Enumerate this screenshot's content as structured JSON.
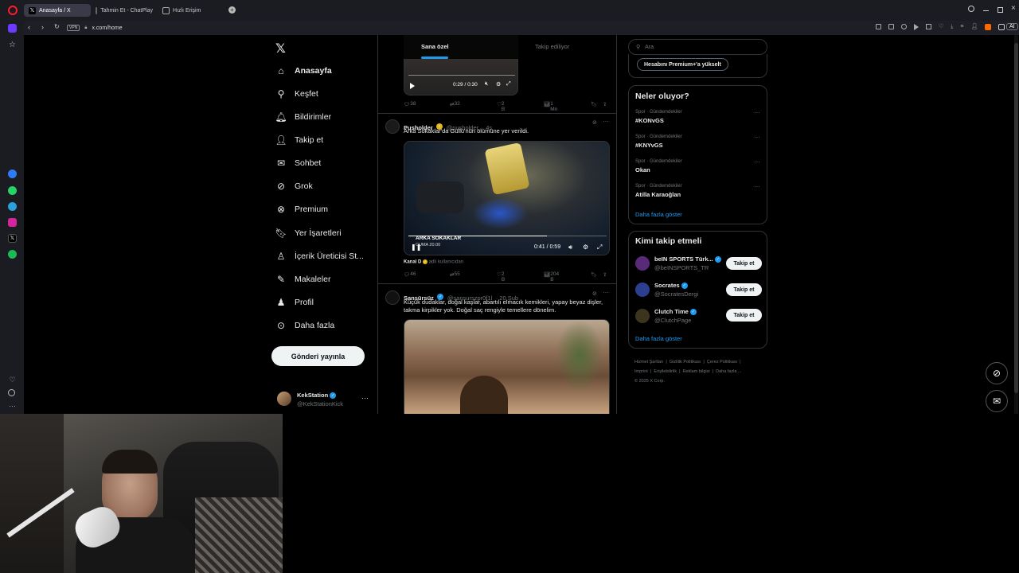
{
  "browser": {
    "tabs": [
      {
        "label": "Anasayfa / X",
        "active": true
      },
      {
        "label": "Tahmin Et - ChatPlay",
        "active": false
      },
      {
        "label": "Hızlı Erişim",
        "active": false
      }
    ],
    "vpn_label": "VPN",
    "url": "x.com/home",
    "ai_label": "AI"
  },
  "nav": {
    "items": [
      {
        "label": "Anasayfa",
        "icon": "home-icon"
      },
      {
        "label": "Keşfet",
        "icon": "search-icon"
      },
      {
        "label": "Bildirimler",
        "icon": "bell-icon"
      },
      {
        "label": "Takip et",
        "icon": "add-person-icon"
      },
      {
        "label": "Sohbet",
        "icon": "mail-icon"
      },
      {
        "label": "Grok",
        "icon": "grok-icon"
      },
      {
        "label": "Premium",
        "icon": "premium-icon"
      },
      {
        "label": "Yer İşaretleri",
        "icon": "bookmark-icon"
      },
      {
        "label": "İçerik Üreticisi St...",
        "icon": "creator-icon"
      },
      {
        "label": "Makaleler",
        "icon": "article-icon"
      },
      {
        "label": "Profil",
        "icon": "profile-icon"
      },
      {
        "label": "Daha fazla",
        "icon": "more-icon"
      }
    ],
    "post_button": "Gönderi yayınla",
    "account": {
      "name": "KekStation",
      "handle": "@KekStationKick",
      "more": "···"
    }
  },
  "feed": {
    "tabs": [
      "Sana özel",
      "Takip ediliyor"
    ],
    "post0": {
      "video_time": "0:29 / 0:30",
      "replies": "38",
      "reposts": "32",
      "likes": "2 B",
      "views": "1 Mn"
    },
    "post1": {
      "name": "Pusholder",
      "handle": "@pusholder",
      "time": "· 4s",
      "text": "Arka Sokaklar'da Güllü'nün ölümüne yer verildi.",
      "video_overlay_title": "ARKA SOKAKLAR",
      "video_overlay_sub": "CUMA 20.00",
      "video_time": "0:41 / 0:59",
      "source_name": "Kanal D",
      "source_note": "adlı kullanıcıdan",
      "replies": "46",
      "reposts": "55",
      "likes": "2 B",
      "views": "204 B"
    },
    "post2": {
      "name": "Sansürsüz",
      "handle": "@sansurszpr0f1l",
      "time": "· 20 Şub",
      "text_line1": "Küçük dudaklar, doğal kaşlar, abartılı elmacık kemikleri, yapay beyaz dişler,",
      "text_line2": "takma kirpikler yok. Doğal saç rengiyle temellere dönelim."
    }
  },
  "sidebar": {
    "search_placeholder": "Ara",
    "premium_button": "Hesabını Premium+'a yükselt",
    "trends_title": "Neler oluyor?",
    "trends": [
      {
        "category": "Spor · Gündemdekiler",
        "name": "#KONvGS"
      },
      {
        "category": "Spor · Gündemdekiler",
        "name": "#KNYvGS"
      },
      {
        "category": "Spor · Gündemdekiler",
        "name": "Okan"
      },
      {
        "category": "Spor · Gündemdekiler",
        "name": "Atilla Karaoğlan"
      }
    ],
    "trends_more": "Daha fazla göster",
    "who_title": "Kimi takip etmeli",
    "who": [
      {
        "name": "beIN SPORTS Türk...",
        "handle": "@beINSPORTS_TR",
        "button": "Takip et",
        "color": "#5a2a7a"
      },
      {
        "name": "Socrates",
        "handle": "@SocratesDergi",
        "button": "Takip et",
        "color": "#2c3e8f"
      },
      {
        "name": "Clutch Time",
        "handle": "@ClutchPage",
        "button": "Takip et",
        "color": "#3d3420"
      }
    ],
    "who_more": "Daha fazla göster",
    "footer_line1": [
      "Hizmet Şartları",
      "Gizlilik Politikası",
      "Çerez Politikası"
    ],
    "footer_line2": [
      "Imprint",
      "Erişilebilirlik",
      "Reklam bilgisi",
      "Daha fazla ..."
    ],
    "copyright": "© 2025 X Corp."
  },
  "colors": {
    "accent": "#1d9bf0",
    "background": "#000000",
    "border": "#2f3336"
  }
}
